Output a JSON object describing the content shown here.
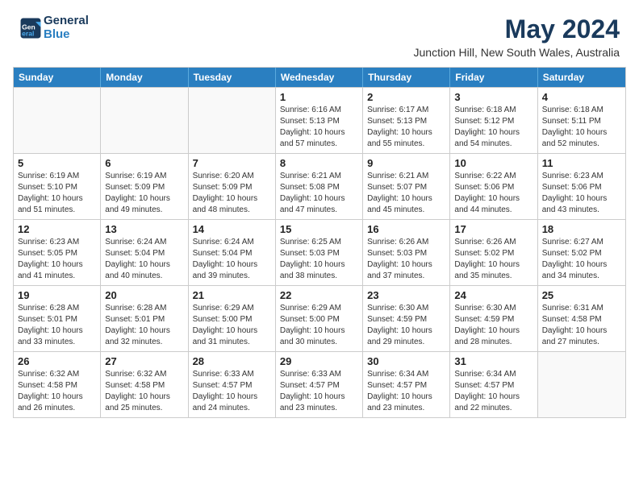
{
  "header": {
    "logo_line1": "General",
    "logo_line2": "Blue",
    "main_title": "May 2024",
    "subtitle": "Junction Hill, New South Wales, Australia"
  },
  "days_of_week": [
    "Sunday",
    "Monday",
    "Tuesday",
    "Wednesday",
    "Thursday",
    "Friday",
    "Saturday"
  ],
  "weeks": [
    [
      {
        "day": "",
        "info": ""
      },
      {
        "day": "",
        "info": ""
      },
      {
        "day": "",
        "info": ""
      },
      {
        "day": "1",
        "info": "Sunrise: 6:16 AM\nSunset: 5:13 PM\nDaylight: 10 hours and 57 minutes."
      },
      {
        "day": "2",
        "info": "Sunrise: 6:17 AM\nSunset: 5:13 PM\nDaylight: 10 hours and 55 minutes."
      },
      {
        "day": "3",
        "info": "Sunrise: 6:18 AM\nSunset: 5:12 PM\nDaylight: 10 hours and 54 minutes."
      },
      {
        "day": "4",
        "info": "Sunrise: 6:18 AM\nSunset: 5:11 PM\nDaylight: 10 hours and 52 minutes."
      }
    ],
    [
      {
        "day": "5",
        "info": "Sunrise: 6:19 AM\nSunset: 5:10 PM\nDaylight: 10 hours and 51 minutes."
      },
      {
        "day": "6",
        "info": "Sunrise: 6:19 AM\nSunset: 5:09 PM\nDaylight: 10 hours and 49 minutes."
      },
      {
        "day": "7",
        "info": "Sunrise: 6:20 AM\nSunset: 5:09 PM\nDaylight: 10 hours and 48 minutes."
      },
      {
        "day": "8",
        "info": "Sunrise: 6:21 AM\nSunset: 5:08 PM\nDaylight: 10 hours and 47 minutes."
      },
      {
        "day": "9",
        "info": "Sunrise: 6:21 AM\nSunset: 5:07 PM\nDaylight: 10 hours and 45 minutes."
      },
      {
        "day": "10",
        "info": "Sunrise: 6:22 AM\nSunset: 5:06 PM\nDaylight: 10 hours and 44 minutes."
      },
      {
        "day": "11",
        "info": "Sunrise: 6:23 AM\nSunset: 5:06 PM\nDaylight: 10 hours and 43 minutes."
      }
    ],
    [
      {
        "day": "12",
        "info": "Sunrise: 6:23 AM\nSunset: 5:05 PM\nDaylight: 10 hours and 41 minutes."
      },
      {
        "day": "13",
        "info": "Sunrise: 6:24 AM\nSunset: 5:04 PM\nDaylight: 10 hours and 40 minutes."
      },
      {
        "day": "14",
        "info": "Sunrise: 6:24 AM\nSunset: 5:04 PM\nDaylight: 10 hours and 39 minutes."
      },
      {
        "day": "15",
        "info": "Sunrise: 6:25 AM\nSunset: 5:03 PM\nDaylight: 10 hours and 38 minutes."
      },
      {
        "day": "16",
        "info": "Sunrise: 6:26 AM\nSunset: 5:03 PM\nDaylight: 10 hours and 37 minutes."
      },
      {
        "day": "17",
        "info": "Sunrise: 6:26 AM\nSunset: 5:02 PM\nDaylight: 10 hours and 35 minutes."
      },
      {
        "day": "18",
        "info": "Sunrise: 6:27 AM\nSunset: 5:02 PM\nDaylight: 10 hours and 34 minutes."
      }
    ],
    [
      {
        "day": "19",
        "info": "Sunrise: 6:28 AM\nSunset: 5:01 PM\nDaylight: 10 hours and 33 minutes."
      },
      {
        "day": "20",
        "info": "Sunrise: 6:28 AM\nSunset: 5:01 PM\nDaylight: 10 hours and 32 minutes."
      },
      {
        "day": "21",
        "info": "Sunrise: 6:29 AM\nSunset: 5:00 PM\nDaylight: 10 hours and 31 minutes."
      },
      {
        "day": "22",
        "info": "Sunrise: 6:29 AM\nSunset: 5:00 PM\nDaylight: 10 hours and 30 minutes."
      },
      {
        "day": "23",
        "info": "Sunrise: 6:30 AM\nSunset: 4:59 PM\nDaylight: 10 hours and 29 minutes."
      },
      {
        "day": "24",
        "info": "Sunrise: 6:30 AM\nSunset: 4:59 PM\nDaylight: 10 hours and 28 minutes."
      },
      {
        "day": "25",
        "info": "Sunrise: 6:31 AM\nSunset: 4:58 PM\nDaylight: 10 hours and 27 minutes."
      }
    ],
    [
      {
        "day": "26",
        "info": "Sunrise: 6:32 AM\nSunset: 4:58 PM\nDaylight: 10 hours and 26 minutes."
      },
      {
        "day": "27",
        "info": "Sunrise: 6:32 AM\nSunset: 4:58 PM\nDaylight: 10 hours and 25 minutes."
      },
      {
        "day": "28",
        "info": "Sunrise: 6:33 AM\nSunset: 4:57 PM\nDaylight: 10 hours and 24 minutes."
      },
      {
        "day": "29",
        "info": "Sunrise: 6:33 AM\nSunset: 4:57 PM\nDaylight: 10 hours and 23 minutes."
      },
      {
        "day": "30",
        "info": "Sunrise: 6:34 AM\nSunset: 4:57 PM\nDaylight: 10 hours and 23 minutes."
      },
      {
        "day": "31",
        "info": "Sunrise: 6:34 AM\nSunset: 4:57 PM\nDaylight: 10 hours and 22 minutes."
      },
      {
        "day": "",
        "info": ""
      }
    ]
  ]
}
